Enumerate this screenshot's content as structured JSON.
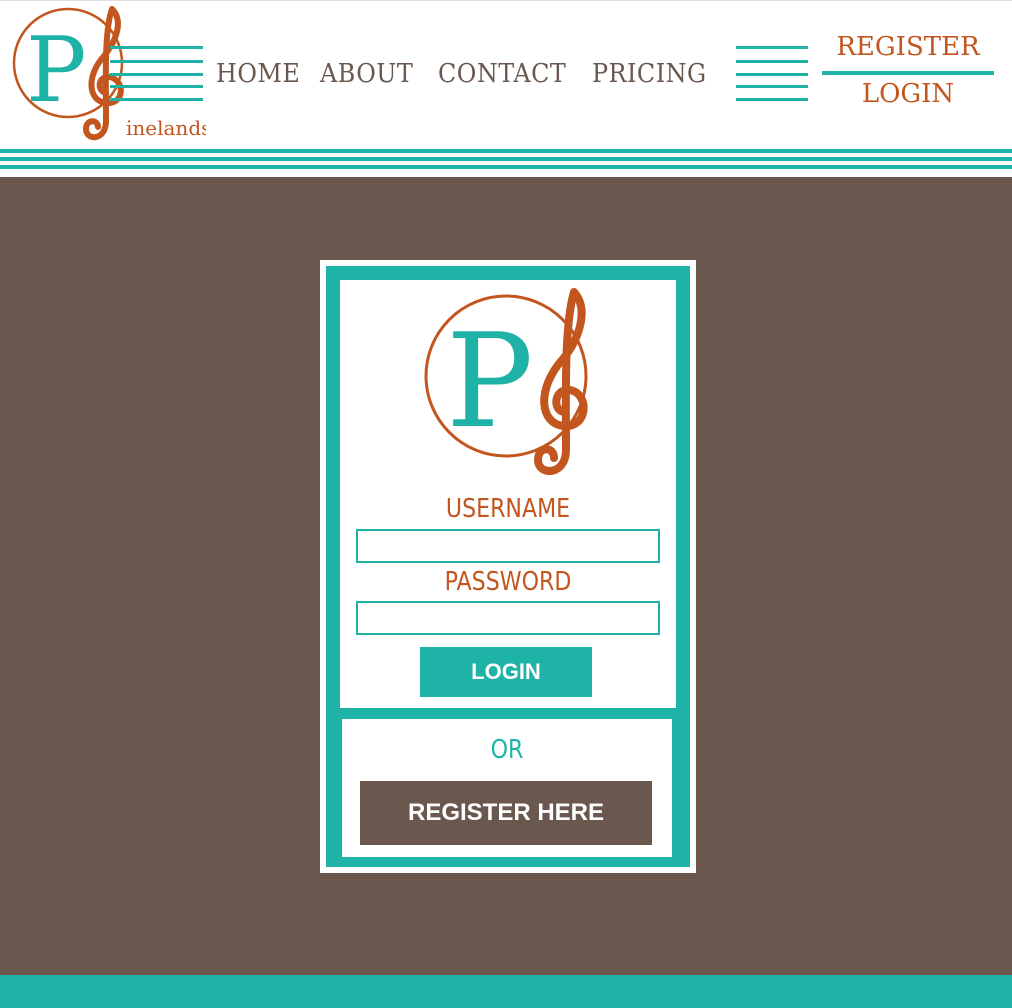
{
  "brand": {
    "logo_letter": "P",
    "logo_text": "inelands"
  },
  "nav": {
    "items": [
      "HOME",
      "ABOUT",
      "CONTACT",
      "PRICING"
    ]
  },
  "auth": {
    "register": "REGISTER",
    "login": "LOGIN"
  },
  "form": {
    "logo_letter": "P",
    "username_label": "USERNAME",
    "username_value": "",
    "password_label": "PASSWORD",
    "password_value": "",
    "login_button": "LOGIN",
    "or_text": "OR",
    "register_button": "REGISTER HERE"
  },
  "colors": {
    "teal": "#1fb3a8",
    "brown": "#6a574e",
    "orange": "#c2561e"
  }
}
